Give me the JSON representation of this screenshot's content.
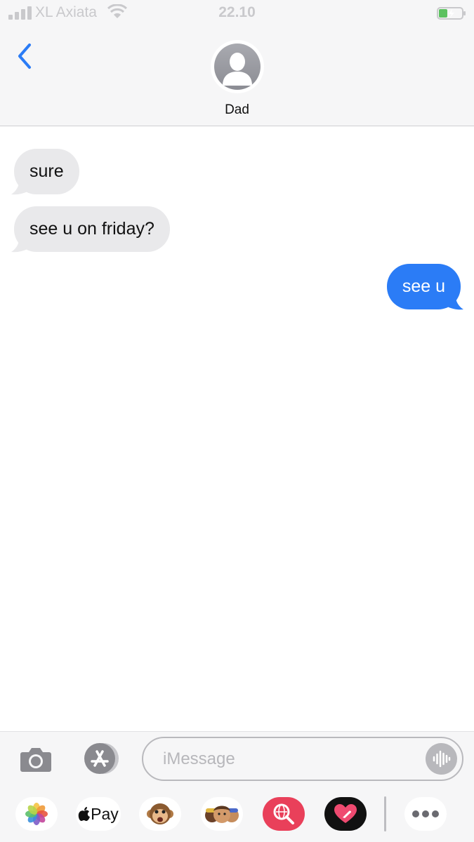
{
  "status_bar": {
    "carrier": "XL Axiata",
    "time": "22.10"
  },
  "header": {
    "contact_name": "Dad"
  },
  "messages": [
    {
      "direction": "incoming",
      "text": "sure"
    },
    {
      "direction": "incoming",
      "text": "see u on friday?"
    },
    {
      "direction": "outgoing",
      "text": "see u"
    }
  ],
  "input": {
    "placeholder": "iMessage"
  },
  "app_drawer": {
    "apple_pay_label": "Pay",
    "apps": [
      "photos-icon",
      "apple-pay-icon",
      "animoji-monkey-icon",
      "memoji-icon",
      "web-image-search-icon",
      "digital-touch-icon",
      "more-icon"
    ]
  },
  "colors": {
    "outgoing": "#2b7cf6",
    "incoming": "#e9e9eb",
    "accent": "#2b7cf6"
  }
}
